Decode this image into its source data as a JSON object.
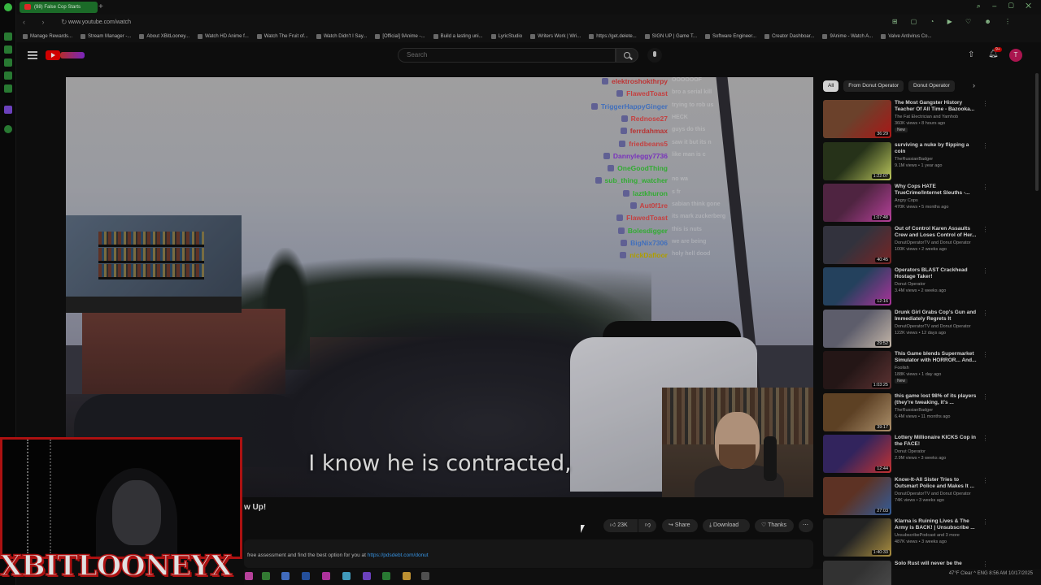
{
  "browser": {
    "tab_title": "(98) False Cop Starts",
    "url": "www.youtube.com/watch",
    "bookmarks": [
      "Manage Rewards...",
      "Stream Manager -...",
      "About XBitLooney...",
      "Watch HD Anime f...",
      "Watch The Fruit of...",
      "Watch Didn't I Say...",
      "[Official] 9Anime -...",
      "Build a lasting uni...",
      "LyricStudio",
      "Writers Work | Wri...",
      "https://get.delete...",
      "SIGN UP | Game T...",
      "Software Engineer...",
      "Creator Dashboar...",
      "9Anime - Watch A...",
      "Valve Antivirus Co..."
    ]
  },
  "header": {
    "search_placeholder": "Search",
    "notification_count": "9+",
    "avatar_letter": "T"
  },
  "player": {
    "caption": "I know he is contracted,",
    "chat": [
      {
        "user": "elektroshokthrpy",
        "color": "#d83b3b",
        "msg": "OOOOOOF"
      },
      {
        "user": "FlawedToast",
        "color": "#e04a4a",
        "msg": "bro a serial kill"
      },
      {
        "user": "TriggerHappyGinger",
        "color": "#4a7fd6",
        "msg": "trying to rob us "
      },
      {
        "user": "Rednose27",
        "color": "#e04a4a",
        "msg": "HECK"
      },
      {
        "user": "ferrdahmax",
        "color": "#d13a3a",
        "msg": "guys do this"
      },
      {
        "user": "friedbeans5",
        "color": "#e04a4a",
        "msg": "saw it but its n"
      },
      {
        "user": "Dannyleggy7736",
        "color": "#8a3ad6",
        "msg": "like man is c"
      },
      {
        "user": "OneGoodThing",
        "color": "#3ac43a",
        "msg": ""
      },
      {
        "user": "sub_thing_watcher",
        "color": "#3ac43a",
        "msg": "no wa"
      },
      {
        "user": "laztkhuron",
        "color": "#3ac43a",
        "msg": "s  fr"
      },
      {
        "user": "Aut0f1re",
        "color": "#e04a4a",
        "msg": "sabian think gone"
      },
      {
        "user": "FlawedToast",
        "color": "#e04a4a",
        "msg": "its mark zuckerberg"
      },
      {
        "user": "Bolesdigger",
        "color": "#3ac43a",
        "msg": "this is nuts"
      },
      {
        "user": "BigNix7306",
        "color": "#4a7fd6",
        "msg": "we are being"
      },
      {
        "user": "nickDafloor",
        "color": "#c8b400",
        "msg": "holy hell dood"
      }
    ]
  },
  "video": {
    "title_partial": "w Up!",
    "likes": "23K",
    "share_label": "Share",
    "download_label": "Download",
    "thanks_label": "Thanks",
    "description_text": "free assessment and find the best option for you at ",
    "description_link": "https://pdsdebt.com/donut"
  },
  "overlay": {
    "name": "XBITLOONEYX"
  },
  "sidebar": {
    "chips": [
      "All",
      "From Donut Operator",
      "Donut Operator"
    ],
    "recommendations": [
      {
        "title": "The Most Gangster History Teacher Of All Time - Bazooka...",
        "channel": "The Fat Electrician and Yamhob",
        "meta": "360K views • 8 hours ago",
        "duration": "36:29",
        "badge": "New",
        "thumb": [
          "#7a4a32",
          "#c21a1a"
        ]
      },
      {
        "title": "surviving a nuke by flipping a coin",
        "channel": "TheRussianBadger",
        "meta": "9.1M views • 1 year ago",
        "duration": "1:22:07",
        "badge": "",
        "thumb": [
          "#2c3a1d",
          "#d6e36a"
        ]
      },
      {
        "title": "Why Cops HATE TrueCrime/Internet Sleuths -...",
        "channel": "Angry Cops",
        "meta": "470K views • 5 months ago",
        "duration": "1:07:48",
        "badge": "",
        "thumb": [
          "#5a2a4a",
          "#d04ab0"
        ]
      },
      {
        "title": "Out of Control Karen Assaults Crew and Loses Control of Her...",
        "channel": "DonutOperatorTV and Donut Operator",
        "meta": "100K views • 2 weeks ago",
        "duration": "40:45",
        "badge": "",
        "thumb": [
          "#3a3a46",
          "#8a2a2a"
        ]
      },
      {
        "title": "Operators BLAST Crackhead Hostage Taker!",
        "channel": "Donut Operator",
        "meta": "3.4M views • 2 weeks ago",
        "duration": "12:16",
        "badge": "",
        "thumb": [
          "#2a4a6a",
          "#c43ab0"
        ]
      },
      {
        "title": "Drunk Girl Grabs Cop's Gun and Immediately Regrets It",
        "channel": "DonutOperatorTV and Donut Operator",
        "meta": "122K views • 12 days ago",
        "duration": "29:52",
        "badge": "",
        "thumb": [
          "#6a6a7a",
          "#e0d0c0"
        ]
      },
      {
        "title": "This Game blends Supermarket Simulator with HORROR... And...",
        "channel": "Foolish",
        "meta": "188K views • 1 day ago",
        "duration": "1:03:25",
        "badge": "New",
        "thumb": [
          "#2a1a1a",
          "#6a3a3a"
        ]
      },
      {
        "title": "this game lost 98% of its players (they're tweaking, it's ...",
        "channel": "TheRussianBadger",
        "meta": "6.4M views • 11 months ago",
        "duration": "39:17",
        "badge": "",
        "thumb": [
          "#6a4a2a",
          "#c4a47a"
        ]
      },
      {
        "title": "Lottery Millionaire KICKS Cop in the FACE!",
        "channel": "Donut Operator",
        "meta": "2.9M views • 3 weeks ago",
        "duration": "12:44",
        "badge": "",
        "thumb": [
          "#3a2a6a",
          "#e03a3a"
        ]
      },
      {
        "title": "Know-It-All Sister Tries to Outsmart Police and Makes It ...",
        "channel": "DonutOperatorTV and Donut Operator",
        "meta": "74K views • 3 weeks ago",
        "duration": "27:03",
        "badge": "",
        "thumb": [
          "#6a3a2a",
          "#3a6ab0"
        ]
      },
      {
        "title": "Klarna is Ruining Lives & The Army is BACK! | Unsubscribe ...",
        "channel": "UnsubscribePodcast and 3 more",
        "meta": "487K views • 3 weeks ago",
        "duration": "1:40:33",
        "badge": "",
        "thumb": [
          "#2a2a2a",
          "#c4a44a"
        ]
      },
      {
        "title": "Solo Rust will never be the",
        "channel": "",
        "meta": "",
        "duration": "",
        "badge": "",
        "thumb": [
          "#3a3a3a",
          "#5a5a5a"
        ]
      }
    ]
  },
  "taskbar": {
    "status": "47°F Clear   ^   ENG   8:56 AM  10/17/2025"
  },
  "colors": {
    "brand_red": "#ff0000",
    "overlay_border": "#c41414",
    "link_blue": "#3ea6ff",
    "tab_green": "#1f7a2e"
  }
}
